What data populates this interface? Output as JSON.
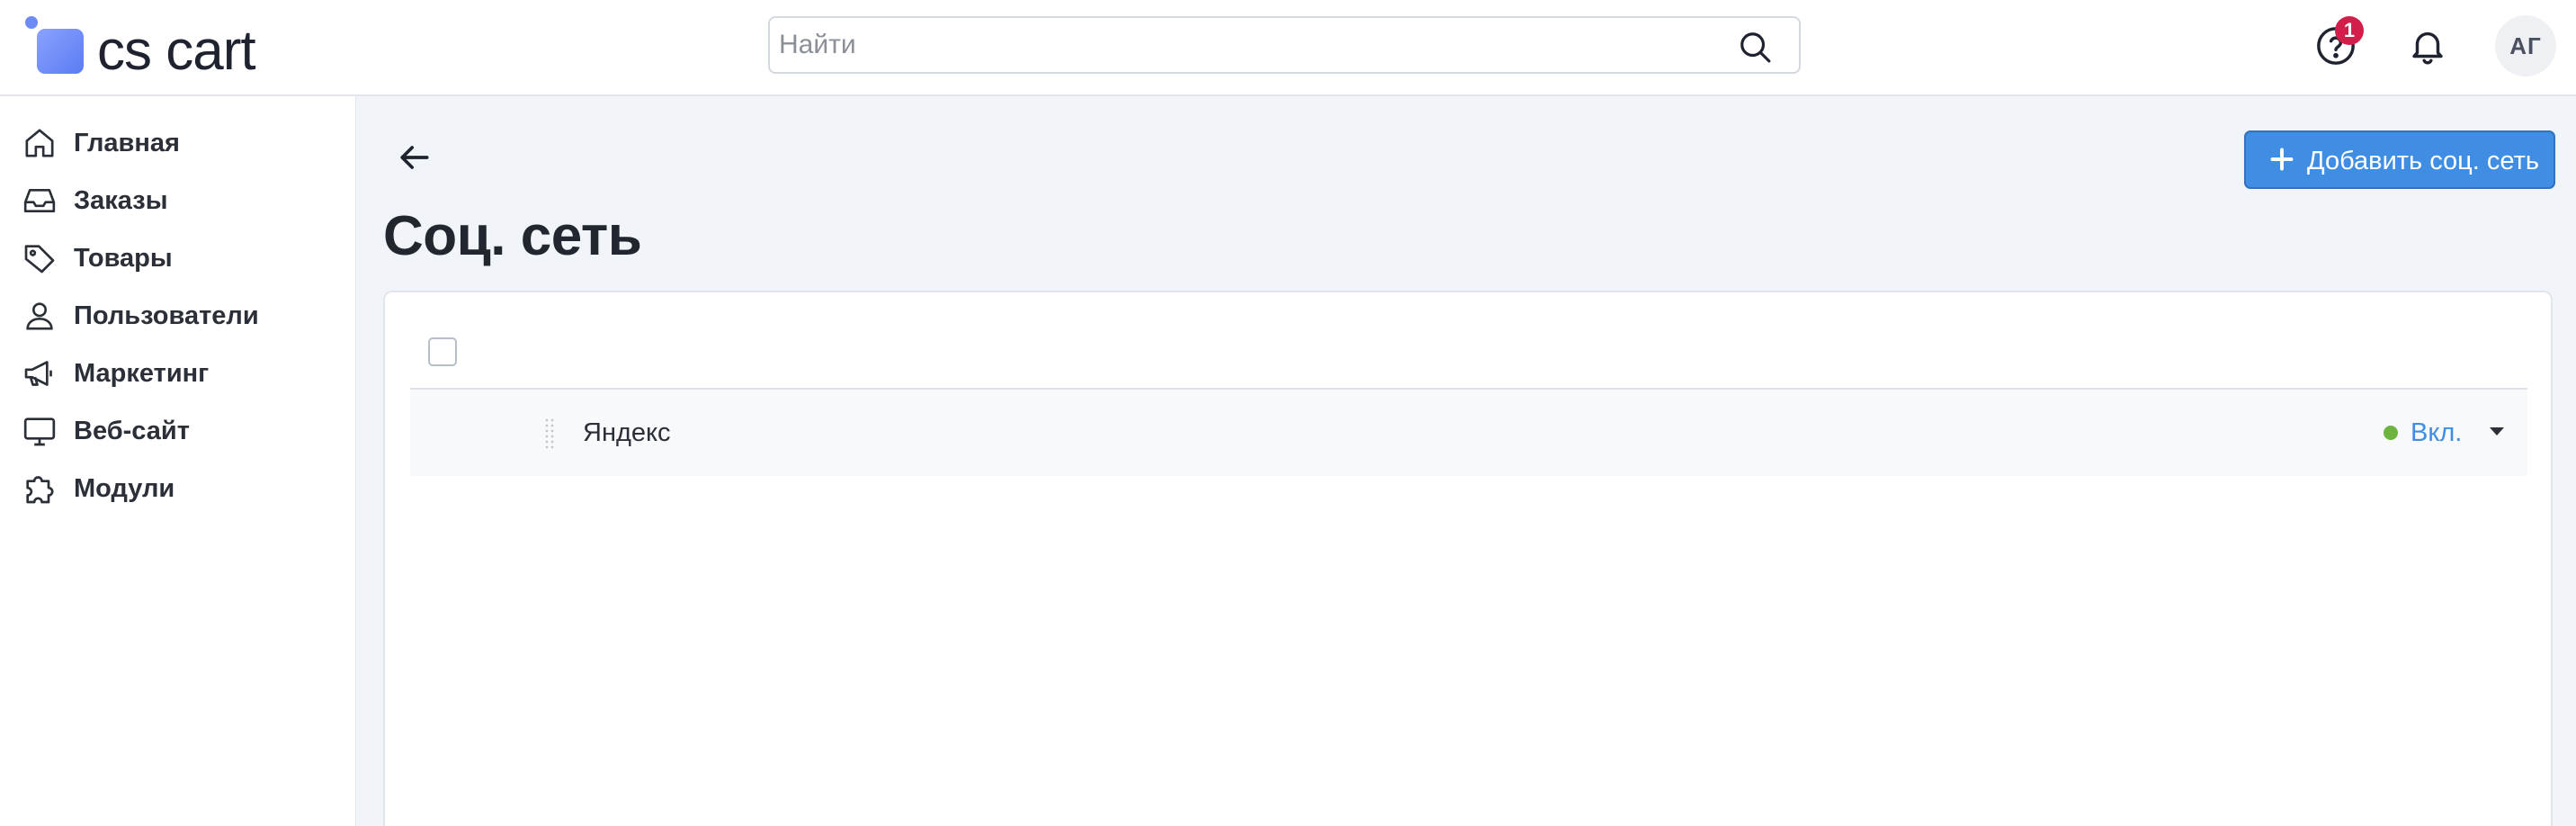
{
  "header": {
    "logo_text": "cs cart",
    "search_placeholder": "Найти",
    "help_badge_count": "1",
    "avatar_initials": "АГ"
  },
  "sidebar": {
    "items": [
      {
        "label": "Главная",
        "icon": "home-icon"
      },
      {
        "label": "Заказы",
        "icon": "inbox-icon"
      },
      {
        "label": "Товары",
        "icon": "tag-icon"
      },
      {
        "label": "Пользователи",
        "icon": "user-icon"
      },
      {
        "label": "Маркетинг",
        "icon": "megaphone-icon"
      },
      {
        "label": "Веб-сайт",
        "icon": "monitor-icon"
      },
      {
        "label": "Модули",
        "icon": "puzzle-icon"
      }
    ]
  },
  "main": {
    "title": "Соц. сеть",
    "add_button_label": "Добавить соц. сеть",
    "rows": [
      {
        "name": "Яндекс",
        "status": "Вкл.",
        "status_color": "#6db33f"
      }
    ]
  },
  "colors": {
    "accent": "#3f8ee3",
    "badge": "#d21e4b",
    "status_on": "#6db33f",
    "content_bg": "#f1f4f8"
  }
}
